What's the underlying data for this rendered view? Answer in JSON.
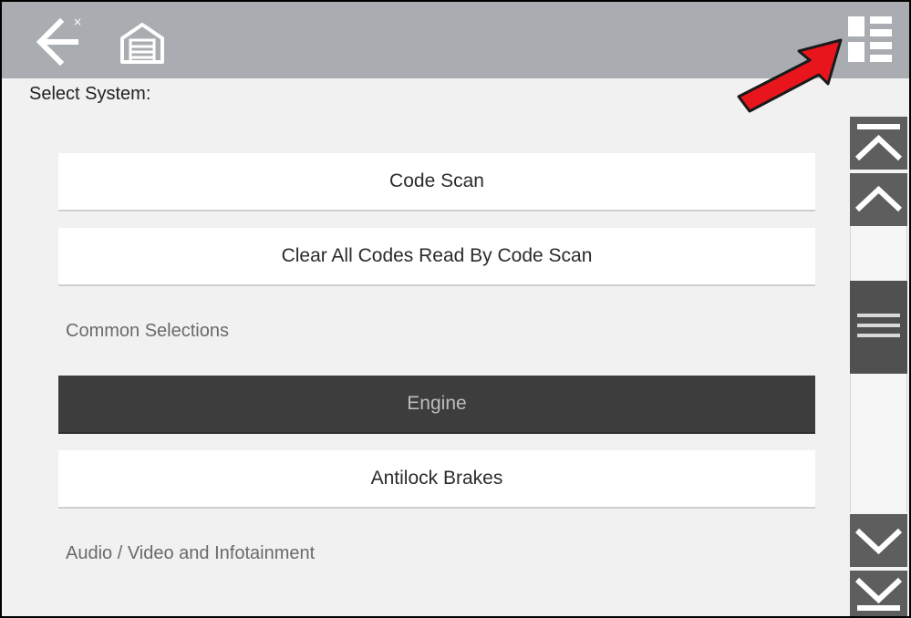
{
  "header": {
    "back_icon": "back-arrow-icon",
    "home_icon": "home-garage-icon",
    "view_icon": "list-view-toggle-icon"
  },
  "page": {
    "prompt": "Select System:"
  },
  "menu": {
    "code_scan": "Code Scan",
    "clear_codes": "Clear All Codes Read By Code Scan",
    "common_section": "Common Selections",
    "engine": "Engine",
    "antilock": "Antilock Brakes",
    "audio_section": "Audio / Video and Infotainment"
  },
  "scrollbar": {
    "top_icon": "scroll-to-top-icon",
    "up_icon": "scroll-up-icon",
    "down_icon": "scroll-down-icon",
    "bottom_icon": "scroll-to-bottom-icon",
    "thumb_icon": "scroll-thumb-grip-icon"
  },
  "annotation": {
    "arrow_color": "#e8161c"
  },
  "colors": {
    "topbar": "#a9adb2",
    "selected": "#3d3d3d",
    "scroll_buttons": "#5e5e5e"
  }
}
